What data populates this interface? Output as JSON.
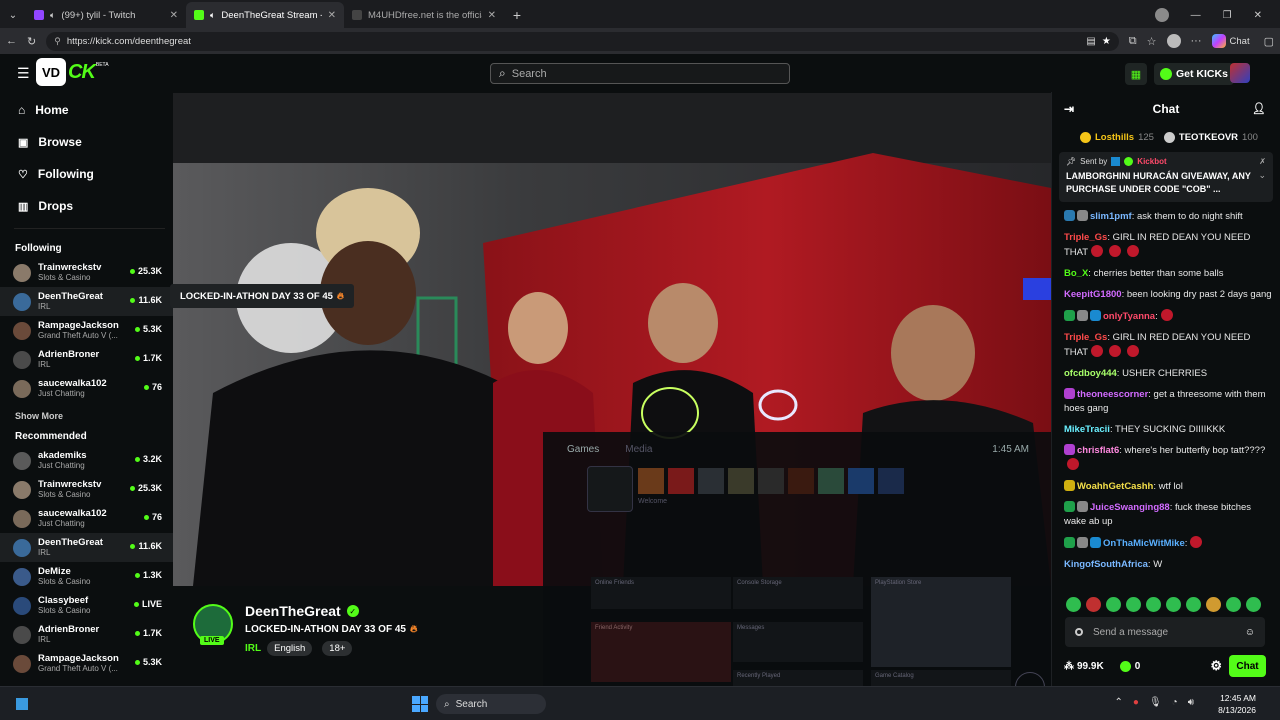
{
  "browser": {
    "tabs": [
      {
        "title": "(99+) tylil - Twitch",
        "active": false
      },
      {
        "title": "DeenTheGreat Stream - Watch",
        "active": true
      },
      {
        "title": "M4UHDfree.net is the official hom",
        "active": false
      }
    ],
    "url": "https://kick.com/deenthegreat",
    "chat_button": "Chat"
  },
  "header": {
    "logo_mark": "VD",
    "logo_text": "CK",
    "logo_beta": "BETA",
    "search_placeholder": "Search",
    "get_kicks": "Get KICKs"
  },
  "nav": [
    {
      "label": "Home",
      "icon": "home-icon"
    },
    {
      "label": "Browse",
      "icon": "browse-icon"
    },
    {
      "label": "Following",
      "icon": "heart-icon"
    },
    {
      "label": "Drops",
      "icon": "drops-icon"
    }
  ],
  "following": {
    "title": "Following",
    "channels": [
      {
        "name": "Trainwreckstv",
        "category": "Slots & Casino",
        "viewers": "25.3K",
        "color": "#8a7a6a"
      },
      {
        "name": "DeenTheGreat",
        "category": "IRL",
        "viewers": "11.6K",
        "color": "#3a6a9a"
      },
      {
        "name": "RampageJackson",
        "category": "Grand Theft Auto V (...",
        "viewers": "5.3K",
        "color": "#6a4a3a"
      },
      {
        "name": "AdrienBroner",
        "category": "IRL",
        "viewers": "1.7K",
        "color": "#4a4a4a"
      },
      {
        "name": "saucewalka102",
        "category": "Just Chatting",
        "viewers": "76",
        "color": "#7a6a5a"
      }
    ],
    "show_more": "Show More"
  },
  "recommended": {
    "title": "Recommended",
    "channels": [
      {
        "name": "akademiks",
        "category": "Just Chatting",
        "viewers": "3.2K",
        "color": "#5a5a5a"
      },
      {
        "name": "Trainwreckstv",
        "category": "Slots & Casino",
        "viewers": "25.3K",
        "color": "#8a7a6a"
      },
      {
        "name": "saucewalka102",
        "category": "Just Chatting",
        "viewers": "76",
        "color": "#7a6a5a"
      },
      {
        "name": "DeenTheGreat",
        "category": "IRL",
        "viewers": "11.6K",
        "color": "#3a6a9a"
      },
      {
        "name": "DeMize",
        "category": "Slots & Casino",
        "viewers": "1.3K",
        "color": "#3a5a8a"
      },
      {
        "name": "Classybeef",
        "category": "Slots & Casino",
        "viewers": "LIVE",
        "color": "#2a4a7a"
      },
      {
        "name": "AdrienBroner",
        "category": "IRL",
        "viewers": "1.7K",
        "color": "#4a4a4a"
      },
      {
        "name": "RampageJackson",
        "category": "Grand Theft Auto V (...",
        "viewers": "5.3K",
        "color": "#6a4a3a"
      }
    ]
  },
  "tooltip": "LOCKED-IN-ATHON DAY 33 OF 45",
  "stream": {
    "name": "DeenTheGreat",
    "title": "LOCKED-IN-ATHON DAY 33 OF 45",
    "category": "IRL",
    "tags": [
      "English",
      "18+"
    ],
    "live_badge": "LIVE"
  },
  "overlay": {
    "tabs": [
      "Games",
      "Media"
    ],
    "time": "1:45 AM",
    "welcome": "Welcome",
    "sections": [
      "Online Friends",
      "Console Storage",
      "PlayStation Store",
      "Friend Activity",
      "Messages",
      "Recently Played",
      "Game Catalog"
    ]
  },
  "chat": {
    "title": "Chat",
    "leaders": [
      {
        "name": "Losthills",
        "count": "125",
        "color": "#f5c518"
      },
      {
        "name": "TEOTKEOVR",
        "count": "100",
        "color": "#ffffff"
      }
    ],
    "pinned": {
      "sent_by": "Sent by",
      "sender": "Kickbot",
      "text": "LAMBORGHINI HURACÁN GIVEAWAY, ANY PURCHASE UNDER CODE \"COB\" ..."
    },
    "messages": [
      {
        "user": "slim1pmf",
        "text": ": ask them to do night shift",
        "color": "#7ab8ff",
        "badges": [
          "#2a7ab0",
          "#888"
        ]
      },
      {
        "user": "Triple_Gs",
        "text": ": GIRL IN RED DEAN YOU NEED THAT",
        "color": "#ff4a4a",
        "badges": [],
        "emotes": 3
      },
      {
        "user": "Bo_X",
        "text": ": cherries better than some balls",
        "color": "#53fc18",
        "badges": []
      },
      {
        "user": "KeepitG1800",
        "text": ": been looking dry past 2 days gang",
        "color": "#d26bff",
        "badges": []
      },
      {
        "user": "onlyTyanna",
        "text": ":",
        "color": "#ff4a6a",
        "badges": [
          "#1fa04a",
          "#888",
          "#1a8ad0"
        ],
        "emotes": 1
      },
      {
        "user": "Triple_Gs",
        "text": ": GIRL IN RED DEAN YOU NEED THAT",
        "color": "#ff4a4a",
        "badges": [],
        "emotes": 3
      },
      {
        "user": "ofcdboy444",
        "text": ": USHER CHERRIES",
        "color": "#a8ff6a",
        "badges": []
      },
      {
        "user": "theoneescorner",
        "text": ": get a threesome with them hoes gang",
        "color": "#d26bff",
        "badges": [
          "#b040d0"
        ]
      },
      {
        "user": "MikeTracii",
        "text": ": THEY SUCKING DIIIIKKK",
        "color": "#6af0ff",
        "badges": []
      },
      {
        "user": "chrisflat6",
        "text": ": where's her butterfly bop tatt????",
        "color": "#ff8ae0",
        "badges": [
          "#b040d0"
        ],
        "emotes": 1
      },
      {
        "user": "WoahhGetCashh",
        "text": ": wtf lol",
        "color": "#f5e04a",
        "badges": [
          "#d0b010"
        ]
      },
      {
        "user": "JuiceSwanging88",
        "text": ": fuck these bitches wake ab up",
        "color": "#d26bff",
        "badges": [
          "#1fa04a",
          "#888"
        ]
      },
      {
        "user": "OnThaMicWitMike",
        "text": ":",
        "color": "#5ab0ff",
        "badges": [
          "#1fa04a",
          "#888",
          "#1a8ad0"
        ],
        "emotes": 1
      },
      {
        "user": "KingofSouthAfrica",
        "text": ": W",
        "color": "#7ab8ff",
        "badges": []
      }
    ],
    "placeholder": "Send a message",
    "points": "99.9K",
    "kicks": "0",
    "send_label": "Chat"
  },
  "taskbar": {
    "search": "Search",
    "time": "12:45 AM",
    "date": "8/13/2026"
  }
}
